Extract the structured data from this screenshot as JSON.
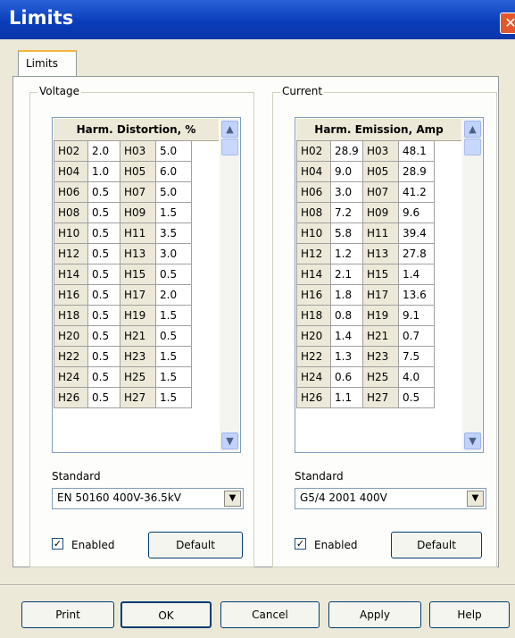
{
  "window": {
    "title": "Limits",
    "close_glyph": "✕"
  },
  "tab": {
    "label": "Limits"
  },
  "voltage": {
    "group_label": "Voltage",
    "grid_header": "Harm. Distortion, %",
    "rows": [
      [
        "H02",
        "2.0",
        "H03",
        "5.0"
      ],
      [
        "H04",
        "1.0",
        "H05",
        "6.0"
      ],
      [
        "H06",
        "0.5",
        "H07",
        "5.0"
      ],
      [
        "H08",
        "0.5",
        "H09",
        "1.5"
      ],
      [
        "H10",
        "0.5",
        "H11",
        "3.5"
      ],
      [
        "H12",
        "0.5",
        "H13",
        "3.0"
      ],
      [
        "H14",
        "0.5",
        "H15",
        "0.5"
      ],
      [
        "H16",
        "0.5",
        "H17",
        "2.0"
      ],
      [
        "H18",
        "0.5",
        "H19",
        "1.5"
      ],
      [
        "H20",
        "0.5",
        "H21",
        "0.5"
      ],
      [
        "H22",
        "0.5",
        "H23",
        "1.5"
      ],
      [
        "H24",
        "0.5",
        "H25",
        "1.5"
      ],
      [
        "H26",
        "0.5",
        "H27",
        "1.5"
      ]
    ],
    "standard_label": "Standard",
    "standard_value": "EN 50160 400V-36.5kV",
    "enabled_label": "Enabled",
    "default_label": "Default"
  },
  "current": {
    "group_label": "Current",
    "grid_header": "Harm. Emission, Amp",
    "rows": [
      [
        "H02",
        "28.9",
        "H03",
        "48.1"
      ],
      [
        "H04",
        "9.0",
        "H05",
        "28.9"
      ],
      [
        "H06",
        "3.0",
        "H07",
        "41.2"
      ],
      [
        "H08",
        "7.2",
        "H09",
        "9.6"
      ],
      [
        "H10",
        "5.8",
        "H11",
        "39.4"
      ],
      [
        "H12",
        "1.2",
        "H13",
        "27.8"
      ],
      [
        "H14",
        "2.1",
        "H15",
        "1.4"
      ],
      [
        "H16",
        "1.8",
        "H17",
        "13.6"
      ],
      [
        "H18",
        "0.8",
        "H19",
        "9.1"
      ],
      [
        "H20",
        "1.4",
        "H21",
        "0.7"
      ],
      [
        "H22",
        "1.3",
        "H23",
        "7.5"
      ],
      [
        "H24",
        "0.6",
        "H25",
        "4.0"
      ],
      [
        "H26",
        "1.1",
        "H27",
        "0.5"
      ]
    ],
    "standard_label": "Standard",
    "standard_value": "G5/4 2001 400V",
    "enabled_label": "Enabled",
    "default_label": "Default"
  },
  "checkbox_glyph": "✓",
  "icons": {
    "scroll_up": "▲",
    "scroll_down": "▼",
    "dropdown": "▼"
  },
  "footer": {
    "print": "Print",
    "ok": "OK",
    "cancel": "Cancel",
    "apply": "Apply",
    "help": "Help"
  }
}
